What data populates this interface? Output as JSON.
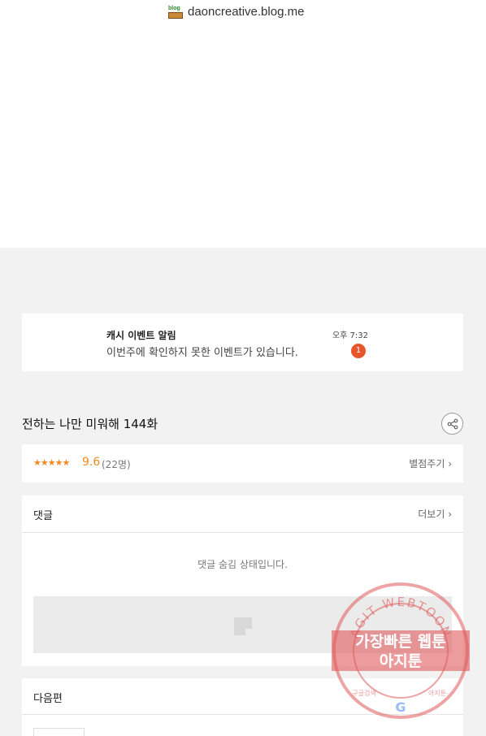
{
  "blog": {
    "url_text": "daoncreative.blog.me",
    "icon": "blog-icon",
    "icon_text": "blog"
  },
  "notification": {
    "title": "캐시 이벤트 알림",
    "message": "이번주에 확인하지 못한 이벤트가 있습니다.",
    "time": "오후 7:32",
    "badge": "1"
  },
  "episode": {
    "title": "전하는 나만 미워해 144화",
    "share_icon": "share-icon"
  },
  "rating": {
    "stars": "★★★★★",
    "score": "9.6",
    "count": "(22명)",
    "rate_label": "별점주기 ›"
  },
  "comments": {
    "label": "댓글",
    "more": "더보기 ›",
    "hidden_message": "댓글 숨김 상태입니다."
  },
  "next": {
    "label": "다음편"
  },
  "watermark": {
    "arc_text": "AGIT WEBTOON",
    "line1": "가장빠른 웹툰",
    "line2": "아지툰",
    "bottom_left": "구글검색",
    "bottom_right": "아지툰",
    "colors": {
      "stamp": "#e05a5a",
      "accent": "#f08a24",
      "badge": "#e8552c"
    }
  }
}
